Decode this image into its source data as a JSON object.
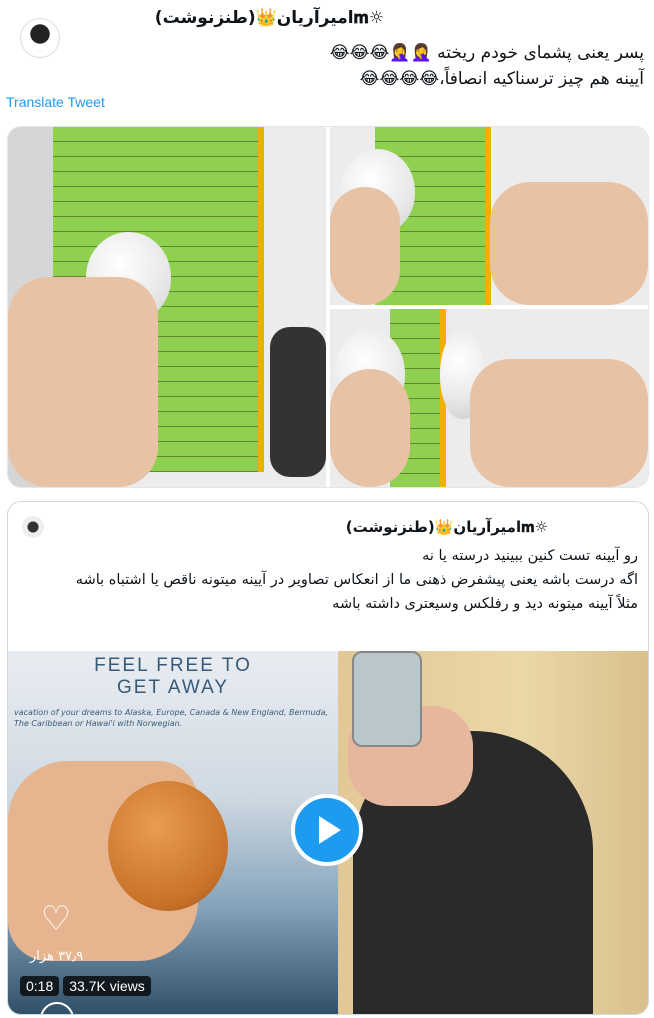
{
  "tweet": {
    "author": "☼𝐦امیرآریان👑(طنزنوشت)",
    "text_line1": "پسر یعنی پشمای خودم ریخته 🤦‍♀️🤦‍♀️😂😂😂",
    "text_line2": "آیینه هم چیز ترسناکیه انصافاً،😂😂😂😂",
    "translate_label": "Translate Tweet"
  },
  "quoted": {
    "author": "☼𝐦امیرآریان👑(طنزنوشت)",
    "line1": "رو آیینه تست کنین ببینید درسته یا نه",
    "line2": "اگه درست باشه یعنی پیشفرض ذهنی ما از انعکاس تصاویر در آیینه میتونه ناقص یا اشتباه باشه",
    "line3": "مثلاً آیینه میتونه دید و رفلکس وسیعتری داشته باشه"
  },
  "video": {
    "poster_title_1": "FEEL FREE TO",
    "poster_title_2": "GET AWAY",
    "poster_sub": "vacation of your dreams to Alaska, Europe, Canada & New England, Bermuda, The Caribbean or Hawai'i with Norwegian.",
    "likes": "۳۷٫۹ هزار",
    "duration": "0:18",
    "views": "33.7K views"
  },
  "icons": {
    "play": "play-icon",
    "heart": "heart-icon"
  },
  "colors": {
    "accent": "#1d9bf0",
    "notebook": "#8fd14f"
  }
}
